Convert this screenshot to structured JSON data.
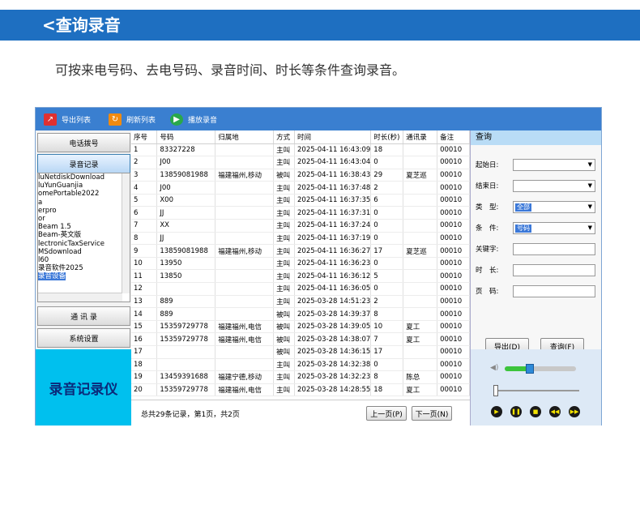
{
  "banner": {
    "title": "<查询录音"
  },
  "description": "可按来电号码、去电号码、录音时间、时长等条件查询录音。",
  "toolbar": {
    "export": "导出列表",
    "refresh": "刷新列表",
    "play": "播放录音"
  },
  "sidebar": {
    "phone_dial": "电话拨号",
    "recordings": "录音记录",
    "tree_items": [
      "luNetdiskDownload",
      "luYunGuanjia",
      "omePortable2022",
      "a",
      "erpro",
      "or",
      "Beam 1.5",
      "Beam-英文版",
      "lectronicTaxService",
      "MSdownload",
      "l60",
      "录音软件2025"
    ],
    "tree_selected": "录音设备",
    "contacts": "通 讯 录",
    "settings": "系统设置",
    "device_name": "录音记录仪"
  },
  "table": {
    "columns": [
      "序号",
      "号码",
      "归属地",
      "方式",
      "时间",
      "时长(秒)",
      "通讯录",
      "备注"
    ],
    "rows": [
      [
        "1",
        "83327228",
        "",
        "主叫",
        "2025-04-11 16:43:09",
        "18",
        "",
        "00010"
      ],
      [
        "2",
        "J00",
        "",
        "主叫",
        "2025-04-11 16:43:04",
        "0",
        "",
        "00010"
      ],
      [
        "3",
        "13859081988",
        "福建福州,移动",
        "被叫",
        "2025-04-11 16:38:43",
        "29",
        "夏芝巡",
        "00010"
      ],
      [
        "4",
        "J00",
        "",
        "主叫",
        "2025-04-11 16:37:48",
        "2",
        "",
        "00010"
      ],
      [
        "5",
        "X00",
        "",
        "主叫",
        "2025-04-11 16:37:35",
        "6",
        "",
        "00010"
      ],
      [
        "6",
        "JJ",
        "",
        "主叫",
        "2025-04-11 16:37:31",
        "0",
        "",
        "00010"
      ],
      [
        "7",
        "XX",
        "",
        "主叫",
        "2025-04-11 16:37:24",
        "0",
        "",
        "00010"
      ],
      [
        "8",
        "JJ",
        "",
        "主叫",
        "2025-04-11 16:37:19",
        "0",
        "",
        "00010"
      ],
      [
        "9",
        "13859081988",
        "福建福州,移动",
        "主叫",
        "2025-04-11 16:36:27",
        "17",
        "夏芝巡",
        "00010"
      ],
      [
        "10",
        "13950",
        "",
        "主叫",
        "2025-04-11 16:36:23",
        "0",
        "",
        "00010"
      ],
      [
        "11",
        "13850",
        "",
        "主叫",
        "2025-04-11 16:36:12",
        "5",
        "",
        "00010"
      ],
      [
        "12",
        "",
        "",
        "主叫",
        "2025-04-11 16:36:05",
        "0",
        "",
        "00010"
      ],
      [
        "13",
        "889",
        "",
        "主叫",
        "2025-03-28 14:51:23",
        "2",
        "",
        "00010"
      ],
      [
        "14",
        "889",
        "",
        "被叫",
        "2025-03-28 14:39:37",
        "8",
        "",
        "00010"
      ],
      [
        "15",
        "15359729778",
        "福建福州,电信",
        "被叫",
        "2025-03-28 14:39:05",
        "10",
        "夏工",
        "00010"
      ],
      [
        "16",
        "15359729778",
        "福建福州,电信",
        "被叫",
        "2025-03-28 14:38:07",
        "7",
        "夏工",
        "00010"
      ],
      [
        "17",
        "",
        "",
        "被叫",
        "2025-03-28 14:36:15",
        "17",
        "",
        "00010"
      ],
      [
        "18",
        "",
        "",
        "主叫",
        "2025-03-28 14:32:38",
        "0",
        "",
        "00010"
      ],
      [
        "19",
        "13459391688",
        "福建宁德,移动",
        "主叫",
        "2025-03-28 14:32:23",
        "8",
        "陈总",
        "00010"
      ],
      [
        "20",
        "15359729778",
        "福建福州,电信",
        "主叫",
        "2025-03-28 14:28:55",
        "18",
        "夏工",
        "00010"
      ]
    ]
  },
  "footer": {
    "summary": "总共29条记录，第1页，共2页",
    "prev": "上一页(P)",
    "next": "下一页(N)"
  },
  "query": {
    "title": "查询",
    "start_date": "起始日:",
    "end_date": "结束日:",
    "type_label": "类　型:",
    "type_value": "全部",
    "condition_label": "条　件:",
    "condition_value": "号码",
    "keyword": "关键字:",
    "duration": "时　长:",
    "page": "页　码:",
    "export_btn": "导出(D)",
    "search_btn": "查询(F)"
  },
  "player": {
    "volume_level": 0.35,
    "progress": 0.0
  },
  "colors": {
    "banner": "#1e6fc1",
    "toolbar": "#3a7fd0",
    "device_panel": "#00c0ee"
  }
}
